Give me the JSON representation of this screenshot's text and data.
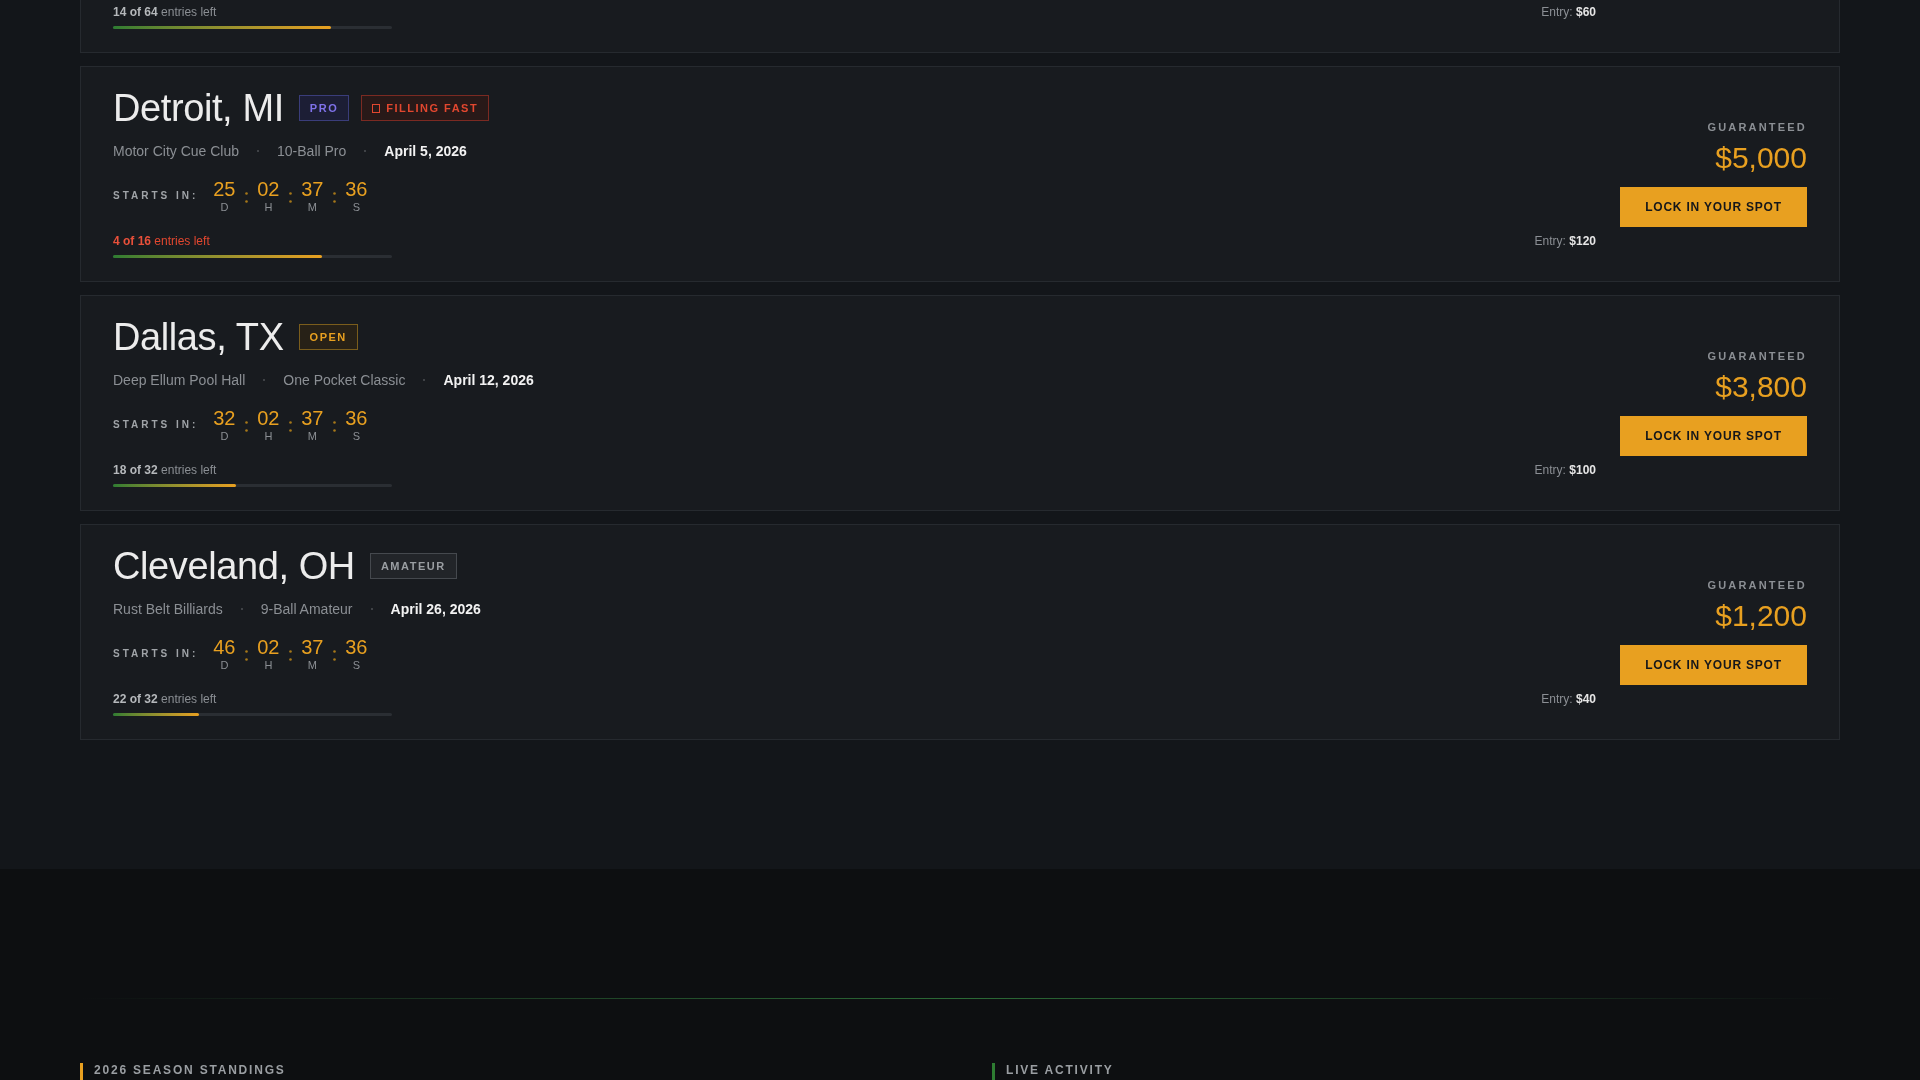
{
  "partial_card": {
    "entries": "**14 of 64** entries left",
    "warning": false,
    "level": 0.78,
    "entry": "Entry: **$60**"
  },
  "tournaments": [
    {
      "city": "Detroit, MI",
      "badges": [
        {
          "label": "PRO",
          "kind": "pro"
        },
        {
          "label": "FILLING FAST",
          "kind": "alert"
        }
      ],
      "venue": "Motor City Cue Club",
      "format": "10-Ball Pro",
      "date": "April 5, 2026",
      "countdown_label": "STARTS IN:",
      "countdown": [
        {
          "value": "25",
          "unit": "D"
        },
        {
          "value": "02",
          "unit": "H"
        },
        {
          "value": "37",
          "unit": "M"
        },
        {
          "value": "36",
          "unit": "S"
        }
      ],
      "entries": "**4 of 16** entries left",
      "warning": true,
      "level": 0.75,
      "entry": "Entry: **$120**",
      "prize_label": "GUARANTEED",
      "prize": "$5,000",
      "button": "LOCK IN YOUR SPOT"
    },
    {
      "city": "Dallas, TX",
      "badges": [
        {
          "label": "OPEN",
          "kind": "open"
        }
      ],
      "venue": "Deep Ellum Pool Hall",
      "format": "One Pocket Classic",
      "date": "April 12, 2026",
      "countdown_label": "STARTS IN:",
      "countdown": [
        {
          "value": "32",
          "unit": "D"
        },
        {
          "value": "02",
          "unit": "H"
        },
        {
          "value": "37",
          "unit": "M"
        },
        {
          "value": "36",
          "unit": "S"
        }
      ],
      "entries": "**18 of 32** entries left",
      "warning": false,
      "level": 0.44,
      "entry": "Entry: **$100**",
      "prize_label": "GUARANTEED",
      "prize": "$3,800",
      "button": "LOCK IN YOUR SPOT"
    },
    {
      "city": "Cleveland, OH",
      "badges": [
        {
          "label": "AMATEUR",
          "kind": "amateur"
        }
      ],
      "venue": "Rust Belt Billiards",
      "format": "9-Ball Amateur",
      "date": "April 26, 2026",
      "countdown_label": "STARTS IN:",
      "countdown": [
        {
          "value": "46",
          "unit": "D"
        },
        {
          "value": "02",
          "unit": "H"
        },
        {
          "value": "37",
          "unit": "M"
        },
        {
          "value": "36",
          "unit": "S"
        }
      ],
      "entries": "**22 of 32** entries left",
      "warning": false,
      "level": 0.31,
      "entry": "Entry: **$40**",
      "prize_label": "GUARANTEED",
      "prize": "$1,200",
      "button": "LOCK IN YOUR SPOT"
    }
  ],
  "footer": {
    "sections": [
      {
        "title": "2026 SEASON STANDINGS",
        "color": "#e8a020"
      },
      {
        "title": "LIVE ACTIVITY",
        "color": "#2e7d32"
      }
    ]
  }
}
